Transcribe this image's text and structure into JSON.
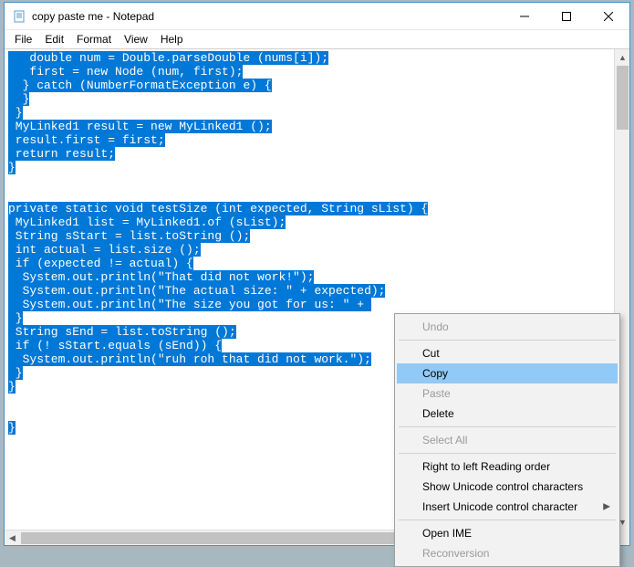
{
  "window": {
    "title": "copy paste me - Notepad"
  },
  "menubar": [
    "File",
    "Edit",
    "Format",
    "View",
    "Help"
  ],
  "code_lines": [
    "   double num = Double.parseDouble (nums[i]);",
    "   first = new Node (num, first);",
    "  } catch (NumberFormatException e) {",
    "  }",
    " }",
    " MyLinked1 result = new MyLinked1 ();",
    " result.first = first;",
    " return result;",
    "}",
    "",
    "",
    "private static void testSize (int expected, String sList) {",
    " MyLinked1 list = MyLinked1.of (sList);",
    " String sStart = list.toString ();",
    " int actual = list.size ();",
    " if (expected != actual) {",
    "  System.out.println(\"That did not work!\");",
    "  System.out.println(\"The actual size: \" + expected);",
    "  System.out.println(\"The size you got for us: \" + ",
    " }",
    " String sEnd = list.toString ();",
    " if (! sStart.equals (sEnd)) {",
    "  System.out.println(\"ruh roh that did not work.\");",
    " }",
    "}",
    "",
    "",
    "}"
  ],
  "context_menu": {
    "items": [
      {
        "label": "Undo",
        "disabled": true
      },
      {
        "sep": true
      },
      {
        "label": "Cut",
        "disabled": false
      },
      {
        "label": "Copy",
        "disabled": false,
        "hover": true
      },
      {
        "label": "Paste",
        "disabled": true
      },
      {
        "label": "Delete",
        "disabled": false
      },
      {
        "sep": true
      },
      {
        "label": "Select All",
        "disabled": true
      },
      {
        "sep": true
      },
      {
        "label": "Right to left Reading order",
        "disabled": false
      },
      {
        "label": "Show Unicode control characters",
        "disabled": false
      },
      {
        "label": "Insert Unicode control character",
        "disabled": false,
        "submenu": true
      },
      {
        "sep": true
      },
      {
        "label": "Open IME",
        "disabled": false
      },
      {
        "label": "Reconversion",
        "disabled": true
      }
    ]
  }
}
